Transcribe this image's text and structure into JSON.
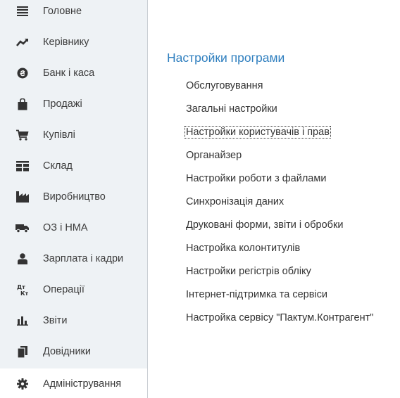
{
  "sidebar": {
    "items": [
      {
        "label": "Головне",
        "icon": "menu-icon"
      },
      {
        "label": "Керівнику",
        "icon": "trend-icon"
      },
      {
        "label": "Банк і каса",
        "icon": "currency-icon"
      },
      {
        "label": "Продажі",
        "icon": "shopping-bag-icon"
      },
      {
        "label": "Купівлі",
        "icon": "cart-icon"
      },
      {
        "label": "Склад",
        "icon": "warehouse-grid-icon"
      },
      {
        "label": "Виробництво",
        "icon": "factory-icon"
      },
      {
        "label": "ОЗ і НМА",
        "icon": "truck-icon"
      },
      {
        "label": "Зарплата і кадри",
        "icon": "person-icon"
      },
      {
        "label": "Операції",
        "icon": "debit-credit-icon"
      },
      {
        "label": "Звіти",
        "icon": "bar-chart-icon"
      },
      {
        "label": "Довідники",
        "icon": "books-icon"
      },
      {
        "label": "Адміністрування",
        "icon": "gear-icon"
      }
    ],
    "active_index": 12,
    "background": "#eef2f5",
    "active_background": "#ffffff"
  },
  "main": {
    "title": "Настройки програми",
    "title_color": "#2f7fbf",
    "links": [
      "Обслуговування",
      "Загальні настройки",
      "Настройки користувачів і прав",
      "Органайзер",
      "Настройки роботи з файлами",
      "Синхронізація даних",
      "Друковані форми, звіти і обробки",
      "Настройка колонтитулів",
      "Настройки регістрів обліку",
      "Інтернет-підтримка та сервіси",
      "Настройка сервісу \"Пактум.Контрагент\""
    ],
    "focused_index": 2
  }
}
